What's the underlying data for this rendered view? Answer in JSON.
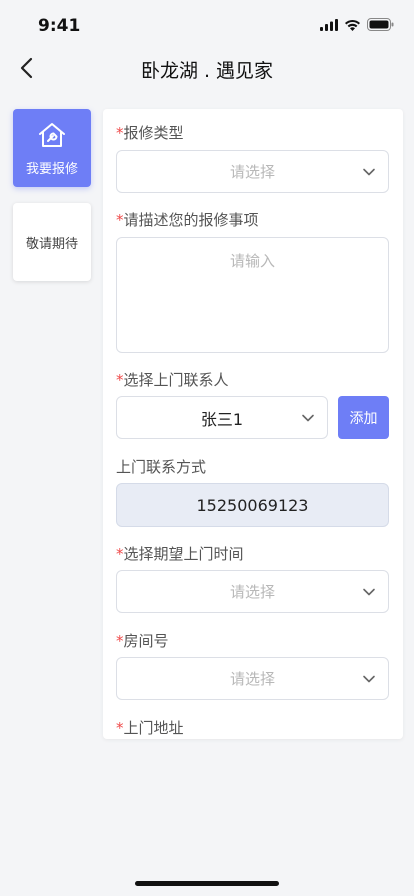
{
  "status_bar": {
    "time": "9:41"
  },
  "nav": {
    "title": "卧龙湖 . 遇见家"
  },
  "sidebar": {
    "items": [
      {
        "label": "我要报修",
        "active": true
      },
      {
        "label": "敬请期待",
        "active": false
      }
    ]
  },
  "form": {
    "required_mark": "*",
    "repair_type": {
      "label": "报修类型",
      "placeholder": "请选择"
    },
    "description": {
      "label": "请描述您的报修事项",
      "placeholder": "请输入"
    },
    "contact": {
      "label": "选择上门联系人",
      "value": "张三1",
      "add_label": "添加"
    },
    "phone": {
      "label": "上门联系方式",
      "value": "15250069123"
    },
    "expected_time": {
      "label": "选择期望上门时间",
      "placeholder": "请选择"
    },
    "room": {
      "label": "房间号",
      "placeholder": "请选择"
    },
    "address": {
      "label": "上门地址"
    }
  },
  "colors": {
    "accent": "#6e7ef6",
    "required": "#ef4a4a",
    "background": "#f4f5f7"
  }
}
